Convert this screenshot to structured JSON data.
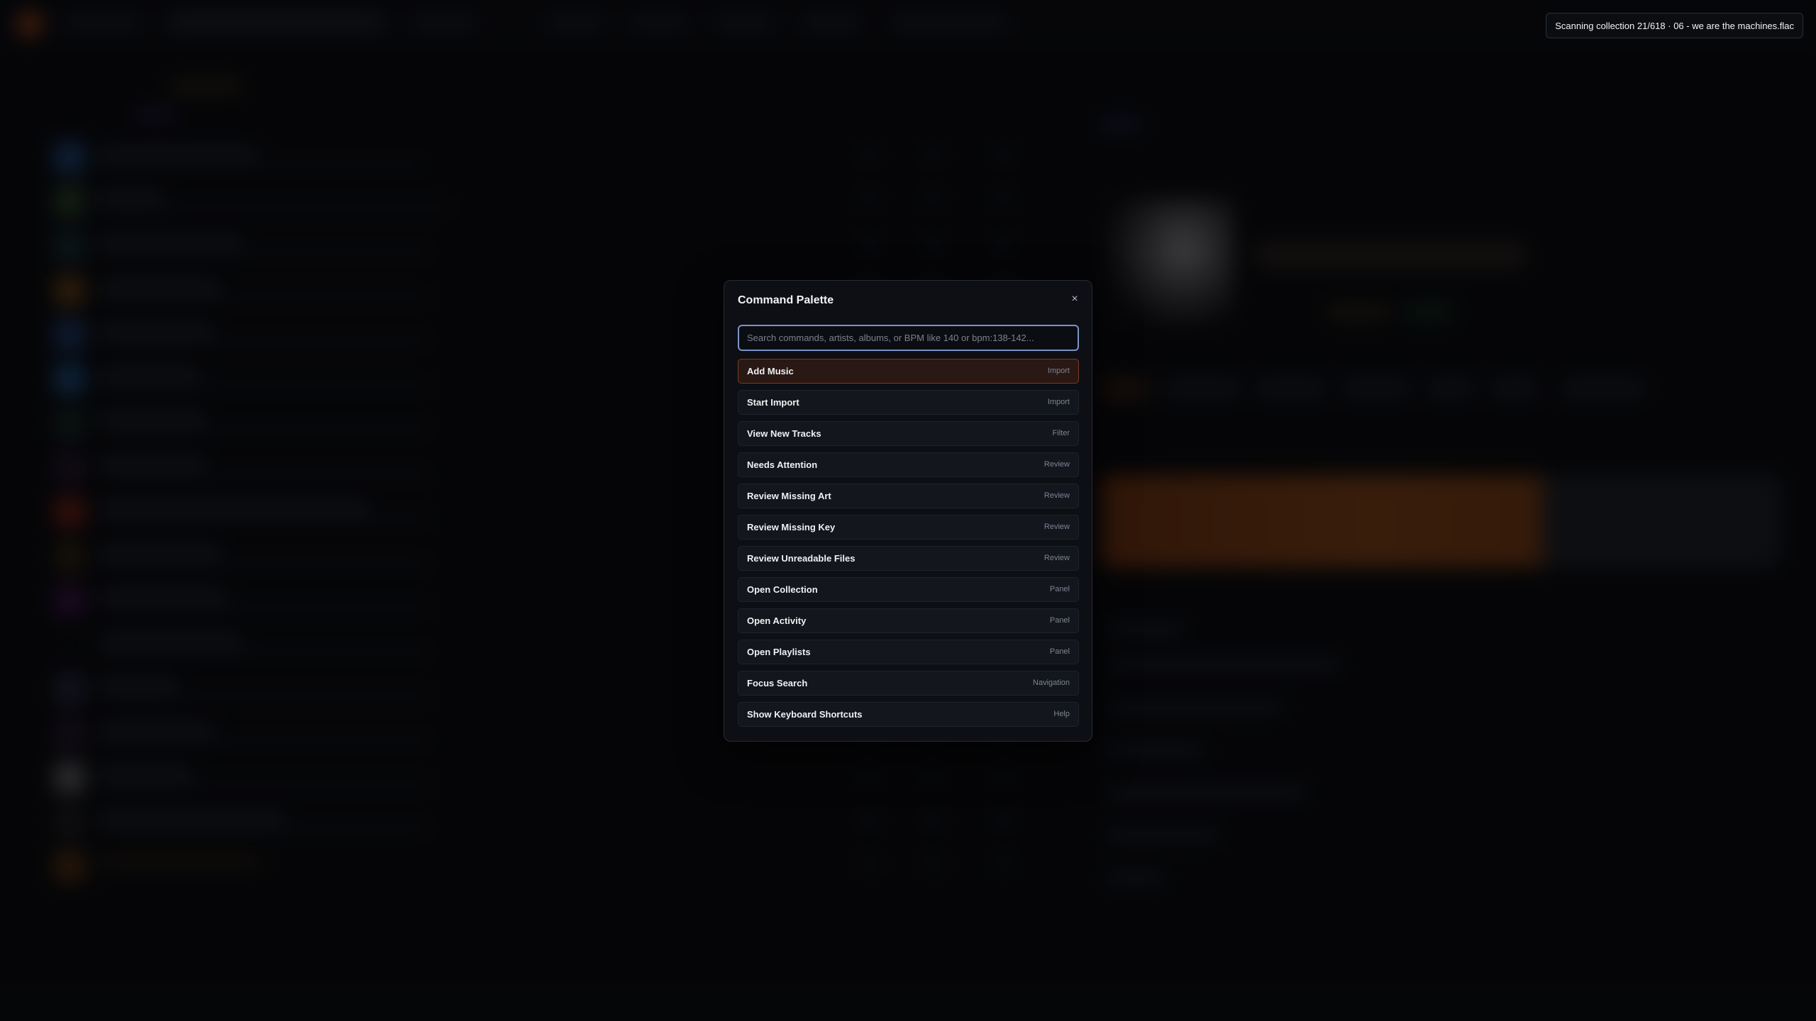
{
  "toast": {
    "message": "Scanning collection 21/618 · 06 - we are the machines.flac"
  },
  "palette": {
    "title": "Command Palette",
    "close_icon": "×",
    "search_placeholder": "Search commands, artists, albums, or BPM like 140 or bpm:138-142...",
    "search_value": "",
    "commands": [
      {
        "label": "Add Music",
        "category": "Import",
        "active": true
      },
      {
        "label": "Start Import",
        "category": "Import",
        "active": false
      },
      {
        "label": "View New Tracks",
        "category": "Filter",
        "active": false
      },
      {
        "label": "Needs Attention",
        "category": "Review",
        "active": false
      },
      {
        "label": "Review Missing Art",
        "category": "Review",
        "active": false
      },
      {
        "label": "Review Missing Key",
        "category": "Review",
        "active": false
      },
      {
        "label": "Review Unreadable Files",
        "category": "Review",
        "active": false
      },
      {
        "label": "Open Collection",
        "category": "Panel",
        "active": false
      },
      {
        "label": "Open Activity",
        "category": "Panel",
        "active": false
      },
      {
        "label": "Open Playlists",
        "category": "Panel",
        "active": false
      },
      {
        "label": "Focus Search",
        "category": "Navigation",
        "active": false
      },
      {
        "label": "Show Keyboard Shortcuts",
        "category": "Help",
        "active": false
      }
    ]
  },
  "colors": {
    "accent": "#ff6a1a",
    "active_item_bg": "#2a1814",
    "active_item_border": "#7a3a22",
    "focus_ring": "#7d93c6"
  }
}
